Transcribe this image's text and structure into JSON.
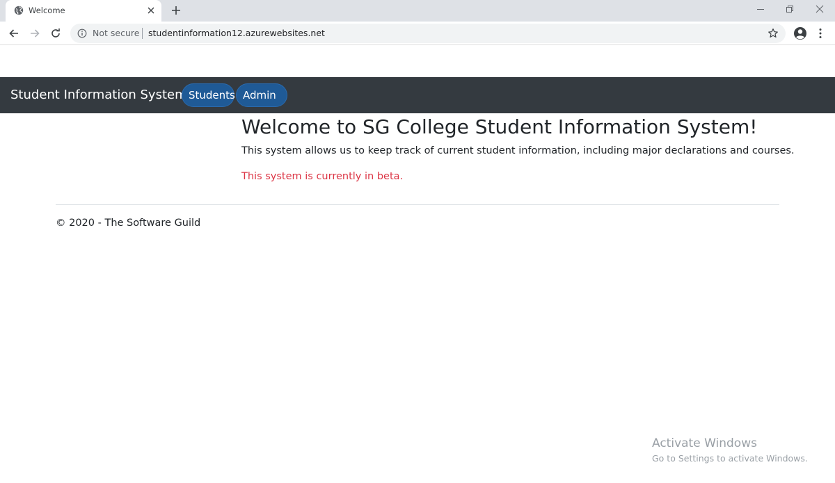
{
  "browser": {
    "tab_title": "Welcome",
    "security_label": "Not secure",
    "url": "studentinformation12.azurewebsites.net"
  },
  "navbar": {
    "brand": "Student Information System",
    "items": [
      {
        "label": "Students"
      },
      {
        "label": "Admin"
      }
    ]
  },
  "main": {
    "title": "Welcome to SG College Student Information System!",
    "description": "This system allows us to keep track of current student information, including major declarations and courses.",
    "beta_notice": "This system is currently in beta."
  },
  "footer": {
    "text": "© 2020 - The Software Guild"
  },
  "watermark": {
    "title": "Activate Windows",
    "subtitle": "Go to Settings to activate Windows."
  },
  "colors": {
    "navbar_bg": "#343a40",
    "pill_bg": "#1f5a96",
    "beta_text": "#dc3545"
  }
}
